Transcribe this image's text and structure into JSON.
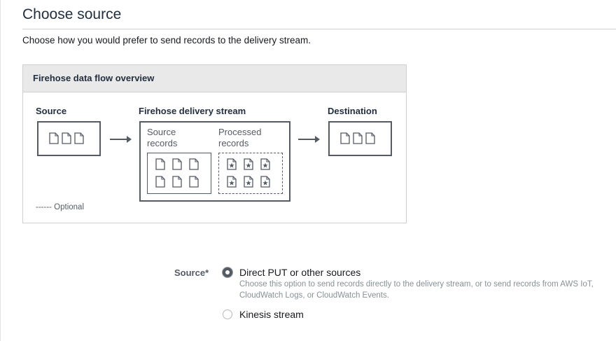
{
  "page": {
    "title": "Choose source",
    "subtitle": "Choose how you would prefer to send records to the delivery stream."
  },
  "overview": {
    "header": "Firehose data flow overview",
    "source_label": "Source",
    "stream_label": "Firehose delivery stream",
    "destination_label": "Destination",
    "source_records_label": "Source records",
    "processed_records_label": "Processed records",
    "optional_legend": "------ Optional"
  },
  "form": {
    "source_label": "Source*",
    "options": [
      {
        "label": "Direct PUT or other sources",
        "description": "Choose this option to send records directly to the delivery stream, or to send records from AWS IoT, CloudWatch Logs, or CloudWatch Events.",
        "selected": true
      },
      {
        "label": "Kinesis stream",
        "selected": false
      }
    ]
  }
}
